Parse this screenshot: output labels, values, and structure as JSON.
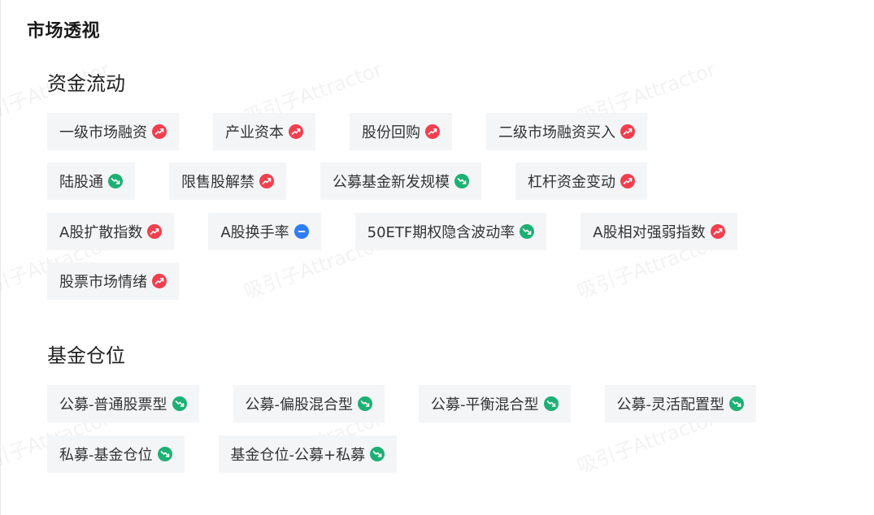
{
  "page": {
    "title": "市场透视"
  },
  "watermark_text": "吸引子Attractor",
  "sections": [
    {
      "title": "资金流动",
      "rows": [
        [
          {
            "label": "一级市场融资",
            "trend": "up"
          },
          {
            "label": "产业资本",
            "trend": "up"
          },
          {
            "label": "股份回购",
            "trend": "up"
          },
          {
            "label": "二级市场融资买入",
            "trend": "up"
          }
        ],
        [
          {
            "label": "陆股通",
            "trend": "down"
          },
          {
            "label": "限售股解禁",
            "trend": "up"
          },
          {
            "label": "公募基金新发规模",
            "trend": "down"
          },
          {
            "label": "杠杆资金变动",
            "trend": "up"
          }
        ],
        [
          {
            "label": "A股扩散指数",
            "trend": "up"
          },
          {
            "label": "A股换手率",
            "trend": "flat"
          },
          {
            "label": "50ETF期权隐含波动率",
            "trend": "down"
          },
          {
            "label": "A股相对强弱指数",
            "trend": "up"
          }
        ],
        [
          {
            "label": "股票市场情绪",
            "trend": "up"
          }
        ]
      ]
    },
    {
      "title": "基金仓位",
      "rows": [
        [
          {
            "label": "公募-普通股票型",
            "trend": "down"
          },
          {
            "label": "公募-偏股混合型",
            "trend": "down"
          },
          {
            "label": "公募-平衡混合型",
            "trend": "down"
          },
          {
            "label": "公募-灵活配置型",
            "trend": "down"
          }
        ],
        [
          {
            "label": "私募-基金仓位",
            "trend": "down"
          },
          {
            "label": "基金仓位-公募+私募",
            "trend": "down"
          }
        ]
      ]
    }
  ],
  "colors": {
    "up": "#f23f4f",
    "down": "#1db074",
    "flat": "#2f7df6",
    "tag_bg": "#f4f5f7"
  },
  "icons": {
    "up": "trend-up-icon",
    "down": "trend-down-icon",
    "flat": "trend-flat-icon"
  }
}
